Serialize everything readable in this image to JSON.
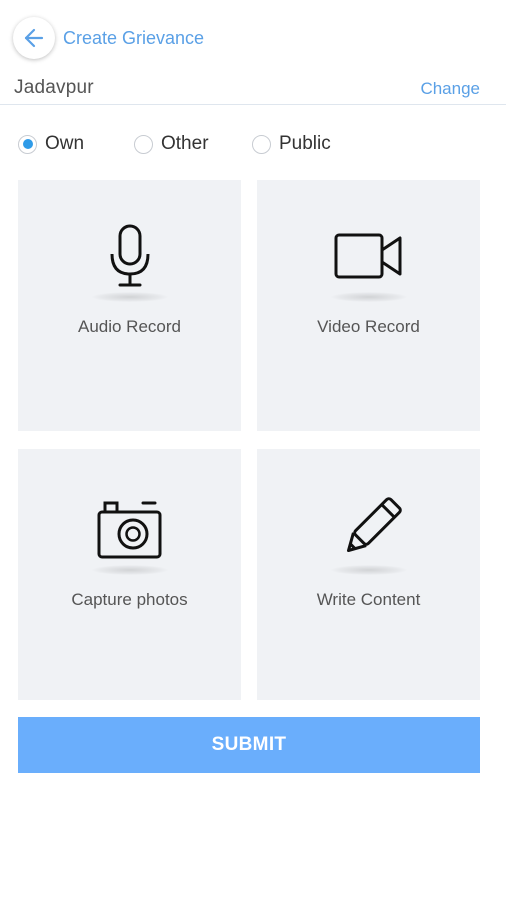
{
  "header": {
    "title": "Create Grievance",
    "back_icon": "arrow-left-icon"
  },
  "location": {
    "value": "Jadavpur",
    "change_label": "Change"
  },
  "grievance_type": {
    "options": [
      {
        "label": "Own",
        "selected": true
      },
      {
        "label": "Other",
        "selected": false
      },
      {
        "label": "Public",
        "selected": false
      }
    ]
  },
  "tiles": [
    {
      "label": "Audio Record",
      "icon": "microphone-icon"
    },
    {
      "label": "Video Record",
      "icon": "video-camera-icon"
    },
    {
      "label": "Capture photos",
      "icon": "camera-icon"
    },
    {
      "label": "Write Content",
      "icon": "pencil-icon"
    }
  ],
  "submit_label": "SUBMIT",
  "colors": {
    "accent": "#5aa0e6",
    "radio_selected": "#2f9be8",
    "submit_bg": "#6aaefc",
    "tile_bg": "#f0f2f5"
  }
}
